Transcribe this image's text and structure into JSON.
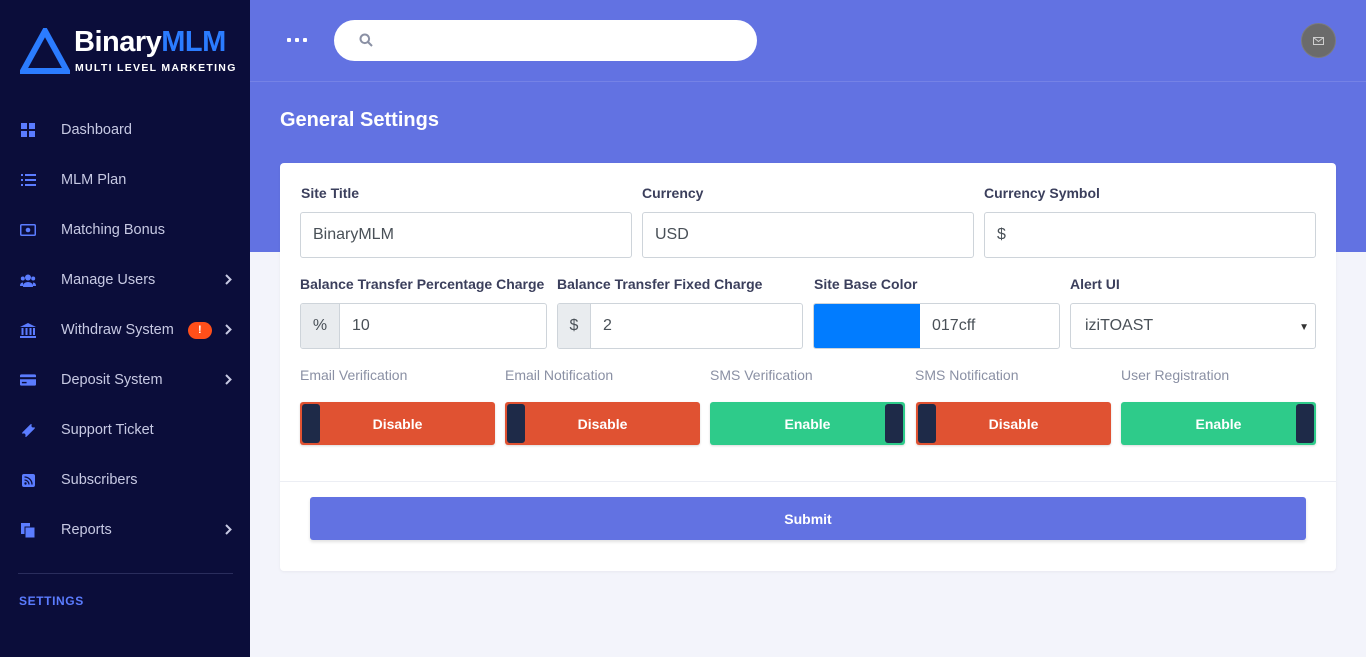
{
  "brand": {
    "name_a": "Binary",
    "name_b": "MLM",
    "tagline": "MULTI LEVEL MARKETING",
    "accent": "#2b7cff"
  },
  "sidebar": {
    "items": [
      {
        "label": "Dashboard",
        "icon": "dashboard-icon"
      },
      {
        "label": "MLM Plan",
        "icon": "list-icon"
      },
      {
        "label": "Matching Bonus",
        "icon": "money-icon"
      },
      {
        "label": "Manage Users",
        "icon": "users-icon"
      },
      {
        "label": "Withdraw System",
        "icon": "bank-icon",
        "badge": "!"
      },
      {
        "label": "Deposit System",
        "icon": "credit-card-icon"
      },
      {
        "label": "Support Ticket",
        "icon": "ticket-icon"
      },
      {
        "label": "Subscribers",
        "icon": "rss-icon"
      },
      {
        "label": "Reports",
        "icon": "reports-icon"
      }
    ],
    "section_heading": "SETTINGS"
  },
  "header": {
    "search_placeholder": ""
  },
  "page": {
    "title": "General Settings"
  },
  "form": {
    "site_title": {
      "label": "Site Title",
      "value": "BinaryMLM"
    },
    "currency": {
      "label": "Currency",
      "value": "USD"
    },
    "currency_symbol": {
      "label": "Currency Symbol",
      "value": "$"
    },
    "bt_percent": {
      "label": "Balance Transfer Percentage Charge",
      "prefix": "%",
      "value": "10"
    },
    "bt_fixed": {
      "label": "Balance Transfer Fixed Charge",
      "prefix": "$",
      "value": "2"
    },
    "base_color": {
      "label": "Site Base Color",
      "value": "017cff",
      "swatch": "#017cff"
    },
    "alert_ui": {
      "label": "Alert UI",
      "value": "iziTOAST"
    },
    "toggles": [
      {
        "label": "Email Verification",
        "state": "Disable"
      },
      {
        "label": "Email Notification",
        "state": "Disable"
      },
      {
        "label": "SMS Verification",
        "state": "Enable"
      },
      {
        "label": "SMS Notification",
        "state": "Disable"
      },
      {
        "label": "User Registration",
        "state": "Enable"
      }
    ],
    "submit_label": "Submit"
  },
  "colors": {
    "primary": "#6272e2",
    "sidebar": "#0b0d3a",
    "enable": "#2ecb8a",
    "disable": "#e05232"
  }
}
